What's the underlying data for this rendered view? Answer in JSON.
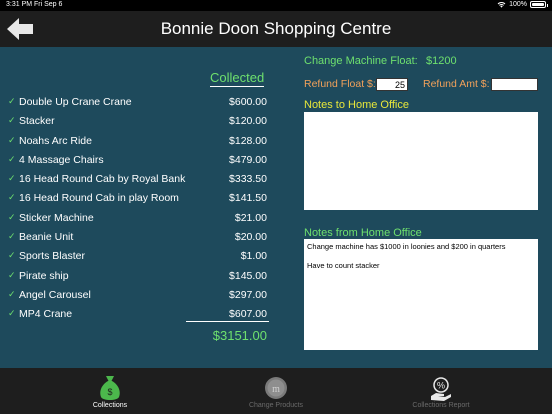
{
  "status_bar": {
    "time": "3:31 PM",
    "date": "Fri Sep 6",
    "battery": "100%"
  },
  "nav": {
    "title": "Bonnie Doon Shopping Centre",
    "back_icon": "back-arrow-icon"
  },
  "collections": {
    "header": "Collected",
    "items": [
      {
        "name": "Double Up Crane Crane",
        "amount": "$600.00"
      },
      {
        "name": "Stacker",
        "amount": "$120.00"
      },
      {
        "name": "Noahs Arc Ride",
        "amount": "$128.00"
      },
      {
        "name": "4 Massage Chairs",
        "amount": "$479.00"
      },
      {
        "name": "16 Head Round Cab by Royal Bank",
        "amount": "$333.50"
      },
      {
        "name": "16 Head Round Cab in play Room",
        "amount": "$141.50"
      },
      {
        "name": "Sticker Machine",
        "amount": "$21.00"
      },
      {
        "name": "Beanie Unit",
        "amount": "$20.00"
      },
      {
        "name": "Sports Blaster",
        "amount": "$1.00"
      },
      {
        "name": "Pirate ship",
        "amount": "$145.00"
      },
      {
        "name": "Angel Carousel",
        "amount": "$297.00"
      },
      {
        "name": "MP4 Crane",
        "amount": "$607.00"
      }
    ],
    "total": "$3151.00"
  },
  "float_panel": {
    "change_machine_label": "Change Machine Float:",
    "change_machine_value": "$1200",
    "refund_float_label": "Refund Float $:",
    "refund_float_value": "25",
    "refund_amt_label": "Refund Amt $:",
    "refund_amt_value": ""
  },
  "notes": {
    "to_label": "Notes to Home Office",
    "to_value": "",
    "from_label": "Notes from Home Office",
    "from_lines": [
      "Change machine has $1000 in loonies and $200 in quarters",
      "Have to count stacker"
    ]
  },
  "tabs": [
    {
      "label": "Collections",
      "icon": "money-bag-icon",
      "active": true
    },
    {
      "label": "Change Products",
      "icon": "coin-icon",
      "active": false
    },
    {
      "label": "Collections Report",
      "icon": "report-hand-icon",
      "active": false
    }
  ],
  "colors": {
    "background": "#1e4a5c",
    "bar": "#1e1e1e",
    "green": "#6ee06e",
    "orange": "#f2a15a",
    "yellow": "#e8e83a"
  }
}
